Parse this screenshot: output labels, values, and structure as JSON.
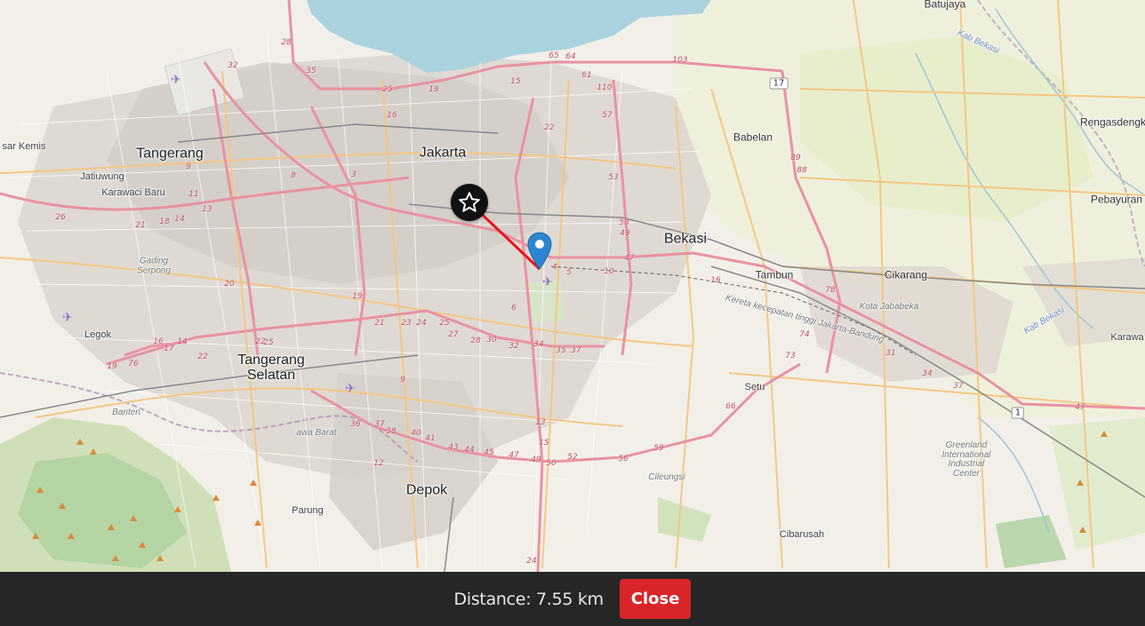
{
  "map": {
    "places": [
      {
        "id": "batujaya",
        "label": "Batujaya",
        "cls": "town"
      },
      {
        "id": "tangerang",
        "label": "Tangerang",
        "cls": "city"
      },
      {
        "id": "jakarta",
        "label": "Jakarta",
        "cls": "city"
      },
      {
        "id": "bekasi",
        "label": "Bekasi",
        "cls": "city"
      },
      {
        "id": "babelan",
        "label": "Babelan",
        "cls": "town"
      },
      {
        "id": "rengasdengklok",
        "label": "Rengasdengk",
        "cls": "town"
      },
      {
        "id": "pebayuran",
        "label": "Pebayuran",
        "cls": "town"
      },
      {
        "id": "jatiuwung",
        "label": "Jatiuwung",
        "cls": "small"
      },
      {
        "id": "karawaci",
        "label": "Karawaci Baru",
        "cls": "small"
      },
      {
        "id": "sarkemis",
        "label": "sar Kemis",
        "cls": "small"
      },
      {
        "id": "tambun",
        "label": "Tambun",
        "cls": "town"
      },
      {
        "id": "cikarang",
        "label": "Cikarang",
        "cls": "town"
      },
      {
        "id": "legok",
        "label": "Legok",
        "cls": "small"
      },
      {
        "id": "tangsel",
        "label": "Tangerang\nSelatan",
        "cls": "city"
      },
      {
        "id": "setu",
        "label": "Setu",
        "cls": "small"
      },
      {
        "id": "depok",
        "label": "Depok",
        "cls": "city"
      },
      {
        "id": "parung",
        "label": "Parung",
        "cls": "small"
      },
      {
        "id": "cibarusah",
        "label": "Cibarusah",
        "cls": "small"
      },
      {
        "id": "karawang",
        "label": "Karawa",
        "cls": "small"
      },
      {
        "id": "gading",
        "label": "Gading\nSerpong",
        "cls": "italic"
      },
      {
        "id": "katajababeka",
        "label": "Kota Jababeka",
        "cls": "italic"
      },
      {
        "id": "greenland",
        "label": "Greenland\nInternational\nIndustrial\nCenter",
        "cls": "italic"
      },
      {
        "id": "cileungsi",
        "label": "Cileungsi",
        "cls": "italic"
      },
      {
        "id": "banten",
        "label": "Banten",
        "cls": "italic"
      },
      {
        "id": "jawabarat",
        "label": "awa Barat",
        "cls": "italic"
      },
      {
        "id": "kabbekasi1",
        "label": "Kab Bekasi",
        "cls": "water-label"
      },
      {
        "id": "kabbekasi2",
        "label": "Kab Bekasi",
        "cls": "water-label"
      },
      {
        "id": "kereta",
        "label": "Kereta kecepatan tinggi Jakarta-Bandung",
        "cls": "italic"
      }
    ],
    "shields": [
      {
        "id": "s17",
        "label": "17"
      },
      {
        "id": "s1",
        "label": "1"
      }
    ],
    "route_numbers": [
      "103",
      "65",
      "64",
      "61",
      "110",
      "57",
      "22",
      "15",
      "25",
      "19",
      "16",
      "28",
      "32",
      "35",
      "26",
      "21",
      "18",
      "14",
      "11",
      "13",
      "9",
      "8",
      "3",
      "5",
      "4",
      "10",
      "47",
      "50",
      "49",
      "53",
      "89",
      "88",
      "78",
      "74",
      "73",
      "66",
      "59",
      "56",
      "52",
      "15",
      "13",
      "24",
      "12",
      "36",
      "37",
      "38",
      "40",
      "41",
      "43",
      "44",
      "45",
      "47",
      "49",
      "50",
      "21",
      "23",
      "24",
      "25",
      "27",
      "28",
      "30",
      "32",
      "34",
      "35",
      "37",
      "31",
      "34",
      "37",
      "47",
      "16",
      "6",
      "19",
      "20",
      "22",
      "17",
      "16",
      "14",
      "76",
      "19",
      "22",
      "9",
      "25"
    ],
    "markers": {
      "origin": "star-marker",
      "destination": "map-pin"
    }
  },
  "footer": {
    "distance_label": "Distance: 7.55 km",
    "close_label": "Close",
    "close_color": "#d9252a",
    "bar_color": "#262626"
  },
  "colors": {
    "land": "#f2efe9",
    "water": "#aad3df",
    "motorway": "#e892a2",
    "primary_road": "#fcd6a4",
    "urban": "#d9d0c9",
    "forest": "#add19e",
    "route_line": "#e8141a"
  }
}
